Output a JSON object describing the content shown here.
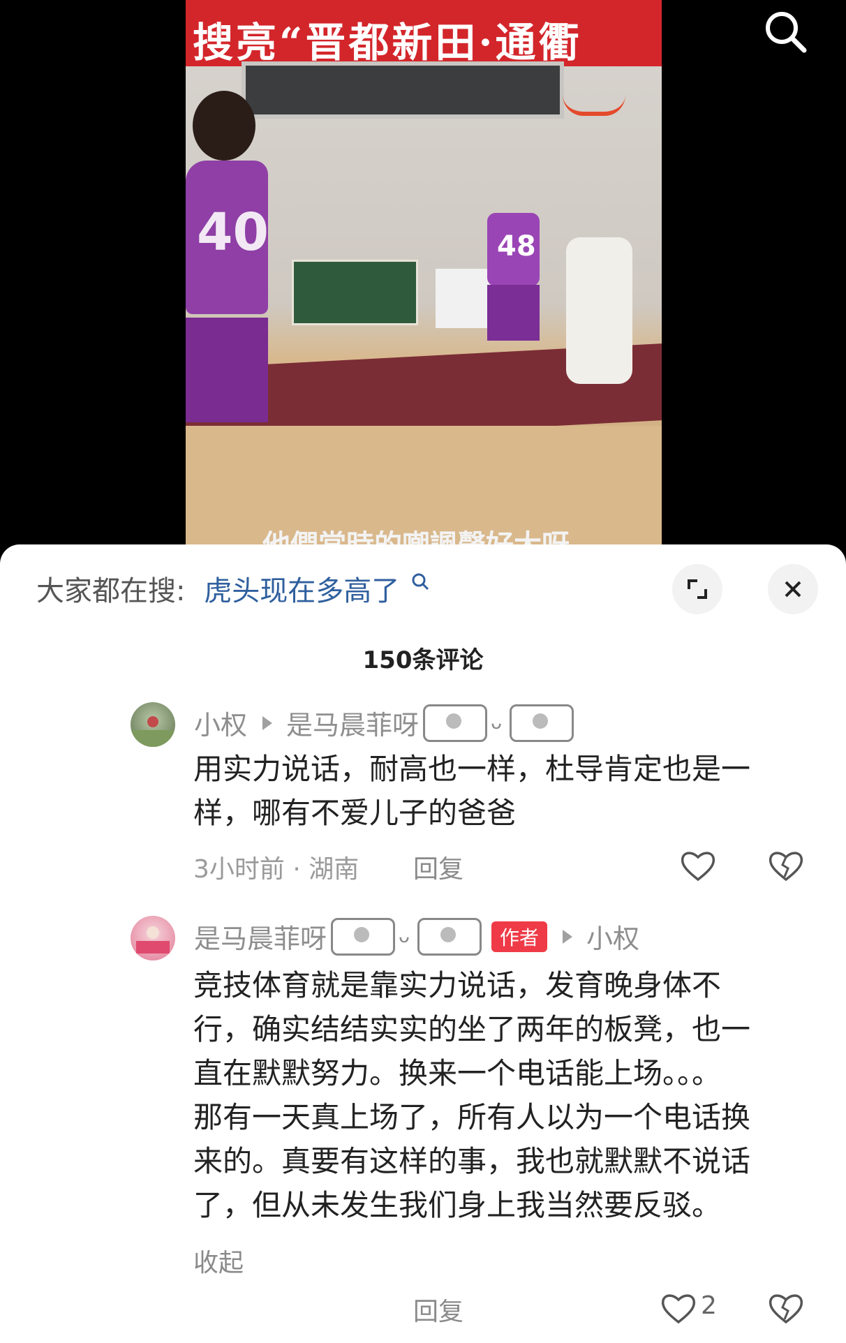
{
  "video": {
    "banner_text": "搜亮“晋都新田·通衢",
    "subtitle": "他們當時的嘲諷聲好大呀",
    "jersey_number_front": "40",
    "jersey_number_back": "48"
  },
  "hot_search": {
    "label": "大家都在搜:",
    "term": "虎头现在多高了"
  },
  "comments_count": "150条评论",
  "comments": [
    {
      "user": "小权",
      "reply_to": "是马晨菲呀",
      "text_lines": [
        "用实力说话，耐高也一样，杜导肯定也是一",
        "样，哪有不爱儿子的爸爸"
      ],
      "time_location": "3小时前 · 湖南",
      "reply_label": "回复"
    },
    {
      "user": "是马晨菲呀",
      "author_tag": "作者",
      "reply_to": "小权",
      "text_lines": [
        "竞技体育就是靠实力说话，发育晚身体不",
        "行，确实结结实实的坐了两年的板凳，也一",
        "直在默默努力。换来一个电话能上场。。。",
        "那有一天真上场了，所有人以为一个电话换",
        "来的。真要有这样的事，我也就默默不说话",
        "了，但从未发生我们身上我当然要反驳。"
      ],
      "collapse_label": "收起",
      "reply_label": "回复",
      "like_count": "2"
    }
  ]
}
